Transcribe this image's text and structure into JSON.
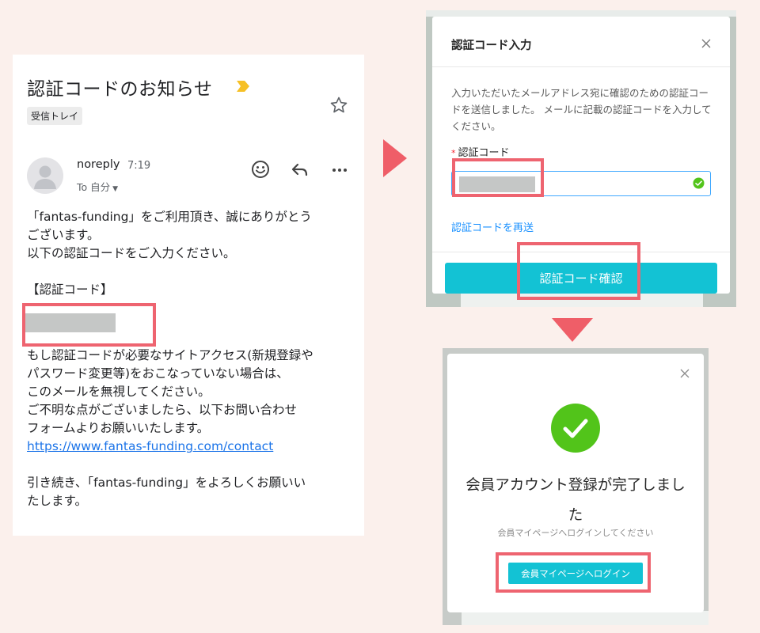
{
  "email": {
    "subject": "認証コードのお知らせ",
    "label": "受信トレイ",
    "sender": "noreply",
    "time": "7:19",
    "to": "To 自分",
    "body_1": "「fantas-funding」をご利用頂き、誠にありがとう\nございます。\n以下の認証コードをご入力ください。",
    "code_heading": "【認証コード】",
    "body_2": "もし認証コードが必要なサイトアクセス(新規登録や\nパスワード変更等)をおこなっていない場合は、\nこのメールを無視してください。\nご不明な点がございましたら、以下お問い合わせ\nフォームよりお願いいたします。",
    "contact_link": "https://www.fantas-funding.com/contact",
    "body_3": "引き続き、「fantas-funding」をよろしくお願いい\nたします。"
  },
  "verify_modal": {
    "title": "認証コード入力",
    "description": "入力いただいたメールアドレス宛に確認のための認証コードを送信しました。 メールに記載の認証コードを入力してください。",
    "required_mark": "*",
    "field_label": "認証コード",
    "resend_link": "認証コードを再送",
    "confirm_button": "認証コード確認"
  },
  "complete_modal": {
    "title": "会員アカウント登録が完了しました",
    "subtitle": "会員マイページへログインしてください",
    "login_button": "会員マイページへログイン"
  },
  "colors": {
    "highlight": "#ee6470",
    "arrow": "#ef5e68",
    "button": "#13c2d4",
    "success": "#52c41a",
    "link": "#1a73e8"
  }
}
